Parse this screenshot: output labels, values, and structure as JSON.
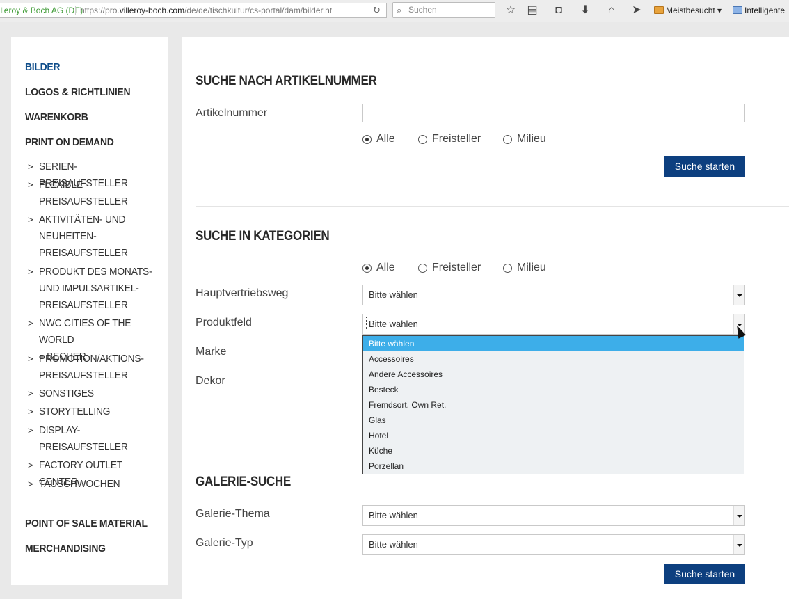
{
  "browser": {
    "site_identity": "Villeroy & Boch AG (DE)",
    "url_prefix": "https://pro.",
    "url_domain": "villeroy-boch.com",
    "url_path": "/de/de/tischkultur/cs-portal/dam/bilder.ht",
    "search_placeholder": "Suchen",
    "bookmark_1": "Meistbesucht",
    "bookmark_2": "Intelligente"
  },
  "sidebar": {
    "main_items": [
      "BILDER",
      "LOGOS & RICHTLINIEN",
      "WARENKORB",
      "PRINT ON DEMAND",
      "POINT OF SALE MATERIAL",
      "MERCHANDISING"
    ],
    "sub_items": [
      [
        "SERIEN-PREISAUFSTELLER"
      ],
      [
        "FLEXIBLE",
        "PREISAUFSTELLER"
      ],
      [
        "AKTIVITÄTEN- UND",
        "NEUHEITEN-",
        "PREISAUFSTELLER"
      ],
      [
        "PRODUKT DES MONATS-",
        "UND IMPULSARTIKEL-",
        "PREISAUFSTELLER"
      ],
      [
        "NWC CITIES OF THE WORLD",
        "– BECHER"
      ],
      [
        "PROMOTION/AKTIONS-",
        "PREISAUFSTELLER"
      ],
      [
        "SONSTIGES"
      ],
      [
        "STORYTELLING"
      ],
      [
        "DISPLAY-",
        "PREISAUFSTELLER"
      ],
      [
        "FACTORY OUTLET CENTER"
      ],
      [
        "TAUSCHWOCHEN"
      ]
    ]
  },
  "section1": {
    "title": "SUCHE NACH ARTIKELNUMMER",
    "field_label": "Artikelnummer",
    "field_value": "",
    "radios": [
      "Alle",
      "Freisteller",
      "Milieu"
    ],
    "button": "Suche starten"
  },
  "section2": {
    "title": "SUCHE IN KATEGORIEN",
    "radios": [
      "Alle",
      "Freisteller",
      "Milieu"
    ],
    "labels": [
      "Hauptvertriebsweg",
      "Produktfeld",
      "Marke",
      "Dekor"
    ],
    "select_value": "Bitte wählen",
    "dropdown_options": [
      "Bitte wählen",
      "Accessoires",
      "Andere Accessoires",
      "Besteck",
      "Fremdsort. Own Ret.",
      "Glas",
      "Hotel",
      "Küche",
      "Porzellan"
    ]
  },
  "section3": {
    "title": "GALERIE-SUCHE",
    "labels": [
      "Galerie-Thema",
      "Galerie-Typ"
    ],
    "select_value": "Bitte wählen",
    "button": "Suche starten"
  }
}
